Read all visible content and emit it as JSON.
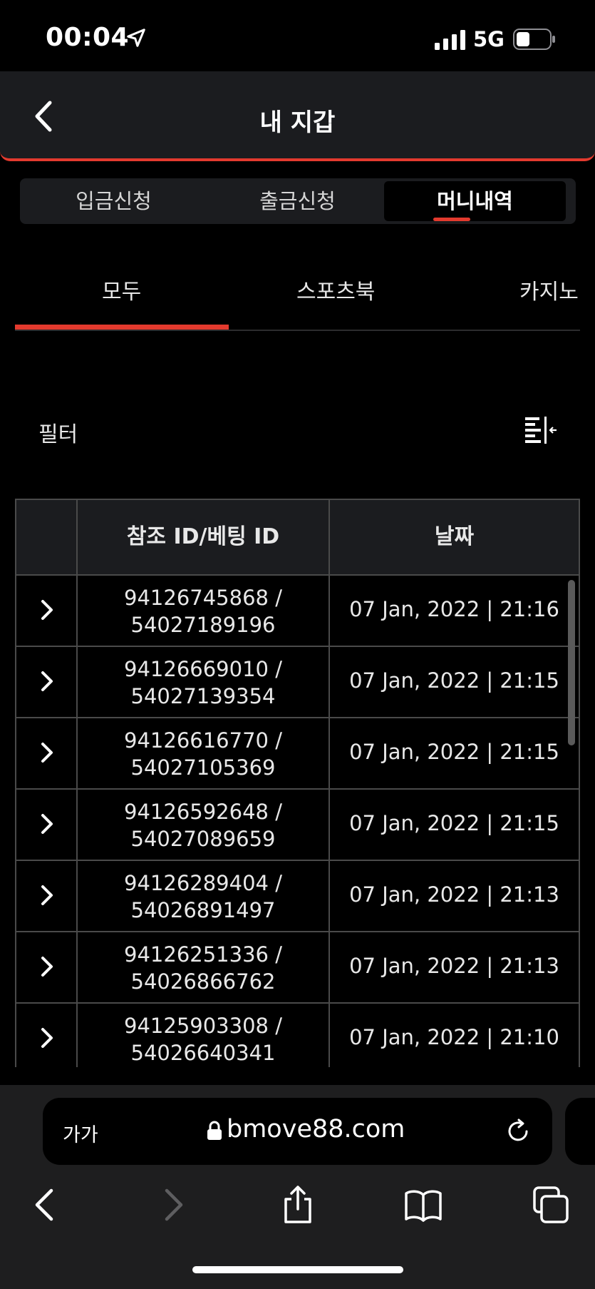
{
  "status": {
    "time": "00:04",
    "network": "5G"
  },
  "header": {
    "title": "내 지갑"
  },
  "segments": [
    "입금신청",
    "출금신청",
    "머니내역"
  ],
  "categories": [
    "모두",
    "스포츠북",
    "카지노"
  ],
  "filter": {
    "label": "필터"
  },
  "table": {
    "headers": [
      "참조 ID/베팅 ID",
      "날짜"
    ],
    "rows": [
      {
        "ref": "94126745868 /",
        "bet": "54027189196",
        "date": "07 Jan, 2022 | 21:16"
      },
      {
        "ref": "94126669010 /",
        "bet": "54027139354",
        "date": "07 Jan, 2022 | 21:15"
      },
      {
        "ref": "94126616770 /",
        "bet": "54027105369",
        "date": "07 Jan, 2022 | 21:15"
      },
      {
        "ref": "94126592648 /",
        "bet": "54027089659",
        "date": "07 Jan, 2022 | 21:15"
      },
      {
        "ref": "94126289404 /",
        "bet": "54026891497",
        "date": "07 Jan, 2022 | 21:13"
      },
      {
        "ref": "94126251336 /",
        "bet": "54026866762",
        "date": "07 Jan, 2022 | 21:13"
      },
      {
        "ref": "94125903308 /",
        "bet": "54026640341",
        "date": "07 Jan, 2022 | 21:10"
      }
    ]
  },
  "browser": {
    "text_size": "가가",
    "url": "bmove88.com"
  }
}
